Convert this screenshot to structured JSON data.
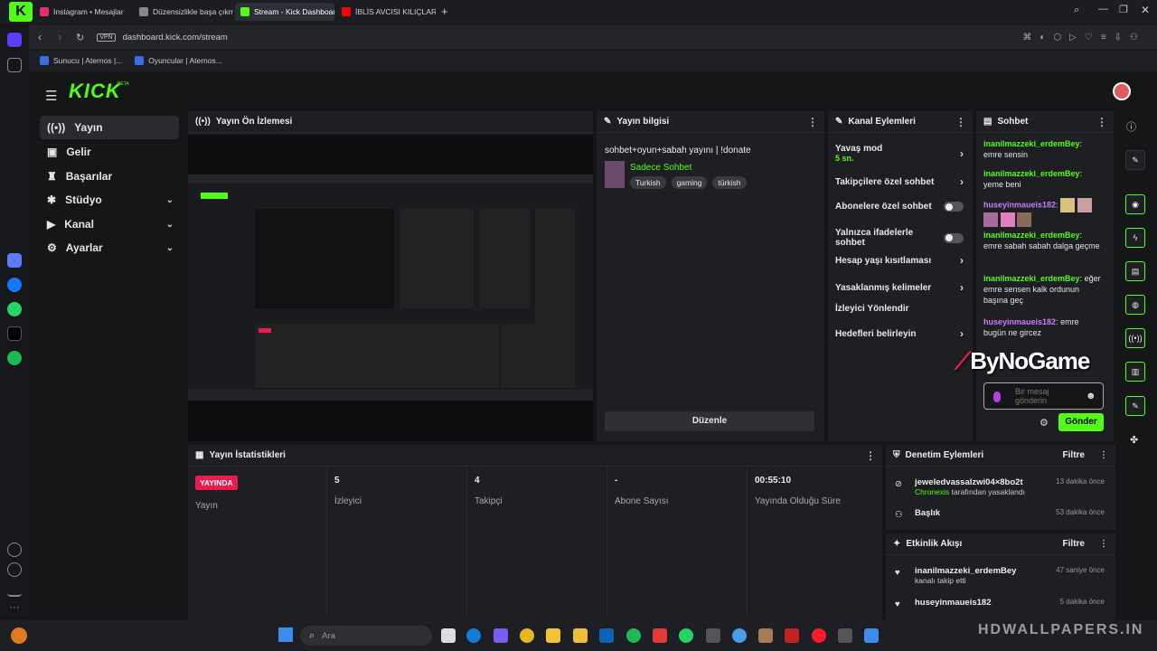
{
  "browser": {
    "tabs": [
      {
        "label": "Instagram • Mesajlar",
        "color": "#e1306c"
      },
      {
        "label": "Düzensizlikle başa çıkma",
        "color": "#888888"
      },
      {
        "label": "Stream - Kick Dashboard",
        "color": "#53fc18",
        "active": true
      },
      {
        "label": "İBLİS AVCISI KILIÇLARI Yap",
        "color": "#ff0000"
      }
    ],
    "vpn_badge": "VPN",
    "url": "dashboard.kick.com/stream",
    "bookmarks": [
      "Sunucu | Aternos |...",
      "Oyuncular | Aternos..."
    ]
  },
  "app": {
    "logo": "KICK",
    "logo_badge": "BETA",
    "nav": [
      {
        "label": "Yayın",
        "icon": "broadcast-icon",
        "selected": true
      },
      {
        "label": "Gelir",
        "icon": "wallet-icon"
      },
      {
        "label": "Başarılar",
        "icon": "trophy-icon"
      },
      {
        "label": "Stüdyo",
        "icon": "studio-icon",
        "chevron": true
      },
      {
        "label": "Kanal",
        "icon": "channel-icon",
        "chevron": true
      },
      {
        "label": "Ayarlar",
        "icon": "settings-icon",
        "chevron": true
      }
    ]
  },
  "preview": {
    "title": "Yayın Ön İzlemesi"
  },
  "stream_info": {
    "title": "Yayın bilgisi",
    "stream_title": "sohbet+oyun+sabah yayını | !donate",
    "category": "Sadece Sohbet",
    "tags": [
      "Turkish",
      "gaming",
      "türkish"
    ],
    "edit_button": "Düzenle"
  },
  "channel_actions": {
    "title": "Kanal Eylemleri",
    "slow_mode": "Yavaş mod",
    "slow_mode_value": "5 sn.",
    "items": [
      {
        "label": "Takipçilere özel sohbet",
        "kind": "arrow"
      },
      {
        "label": "Abonelere özel sohbet",
        "kind": "toggle"
      },
      {
        "label": "Yalnızca ifadelerle sohbet",
        "kind": "toggle"
      },
      {
        "label": "Hesap yaşı kısıtlaması",
        "kind": "arrow"
      },
      {
        "label": "Yasaklanmış kelimeler",
        "kind": "arrow"
      },
      {
        "label": "İzleyici Yönlendir",
        "kind": "none"
      },
      {
        "label": "Hedefleri belirleyin",
        "kind": "arrow"
      }
    ]
  },
  "chat": {
    "title": "Sohbet",
    "messages": [
      {
        "user": "inanilmazzeki_erdemBey",
        "text": "emre sensin",
        "color": "green"
      },
      {
        "user": "inanilmazzeki_erdemBey",
        "text": "yeme beni",
        "color": "green"
      },
      {
        "user": "huseyinmaueis182",
        "text": "",
        "color": "purple"
      },
      {
        "user": "inanilmazzeki_erdemBey",
        "text": "emre sabah sabah dalga geçme",
        "color": "green"
      },
      {
        "user": "inanilmazzeki_erdemBey",
        "text": "eğer emre sensen kalk ordunun başına geç",
        "color": "green"
      },
      {
        "user": "huseyinmaueis182",
        "text": "emre bugün ne gircez",
        "color": "purple"
      }
    ],
    "input_placeholder": "Bir mesaj gönderin",
    "send_button": "Gönder",
    "watermark": "ByNoGame"
  },
  "stats": {
    "title": "Yayın İstatistikleri",
    "live_badge": "YAYINDA",
    "columns": [
      {
        "value": "",
        "label": "Yayın"
      },
      {
        "value": "5",
        "label": "İzleyici"
      },
      {
        "value": "4",
        "label": "Takipçi"
      },
      {
        "value": "-",
        "label": "Abone Sayısı"
      },
      {
        "value": "00:55:10",
        "label": "Yayında Olduğu Süre"
      }
    ]
  },
  "moderation": {
    "title": "Denetim Eylemleri",
    "filter": "Filtre",
    "rows": [
      {
        "title": "jeweledvassalzwi04×8bo2t",
        "sub_user": "Chronexis",
        "sub": "tarafından yasaklandı",
        "time": "13 dakika önce"
      },
      {
        "title": "Başlık",
        "sub_user": "",
        "sub": "",
        "time": "53 dakika önce"
      }
    ]
  },
  "activity": {
    "title": "Etkinlik Akışı",
    "filter": "Filtre",
    "rows": [
      {
        "title": "inanilmazzeki_erdemBey",
        "sub": "kanalı takip etti",
        "time": "47 saniye önce"
      },
      {
        "title": "huseyinmaueis182",
        "sub": "",
        "time": "5 dakika önce"
      }
    ]
  },
  "taskbar": {
    "search_placeholder": "Ara",
    "watermark": "HDWALLPAPERS.IN"
  },
  "colors": {
    "accent": "#53fc18",
    "live": "#e91c4d",
    "panel": "#1e1f22"
  }
}
